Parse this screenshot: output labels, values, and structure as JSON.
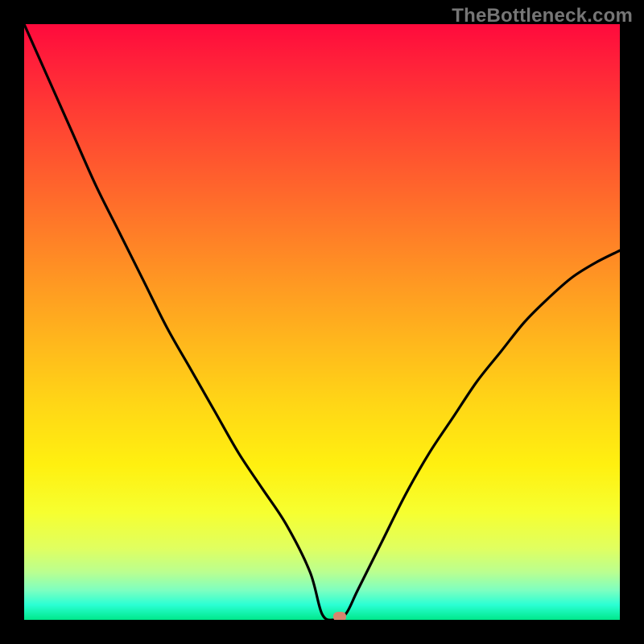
{
  "watermark": "TheBottleneck.com",
  "colors": {
    "frame": "#000000",
    "curve": "#000000",
    "marker": "#d5866e",
    "watermark_text": "#767676",
    "gradient_top": "#ff0a3c",
    "gradient_bottom": "#00e88a"
  },
  "chart_data": {
    "type": "line",
    "title": "",
    "xlabel": "",
    "ylabel": "",
    "xlim": [
      0,
      100
    ],
    "ylim": [
      0,
      100
    ],
    "grid": false,
    "legend": false,
    "series": [
      {
        "name": "bottleneck-curve",
        "x": [
          0,
          4,
          8,
          12,
          16,
          20,
          24,
          28,
          32,
          36,
          40,
          44,
          48,
          50,
          52,
          54,
          56,
          60,
          64,
          68,
          72,
          76,
          80,
          84,
          88,
          92,
          96,
          100
        ],
        "values": [
          100,
          91,
          82,
          73,
          65,
          57,
          49,
          42,
          35,
          28,
          22,
          16,
          8,
          1,
          0,
          1,
          5,
          13,
          21,
          28,
          34,
          40,
          45,
          50,
          54,
          57.5,
          60,
          62
        ]
      }
    ],
    "annotations": [
      {
        "name": "optimum-marker",
        "x": 53,
        "y": 0.5
      }
    ],
    "background": {
      "type": "vertical-gradient-red-to-green",
      "meaning": "red = high bottleneck, green = low bottleneck"
    }
  }
}
